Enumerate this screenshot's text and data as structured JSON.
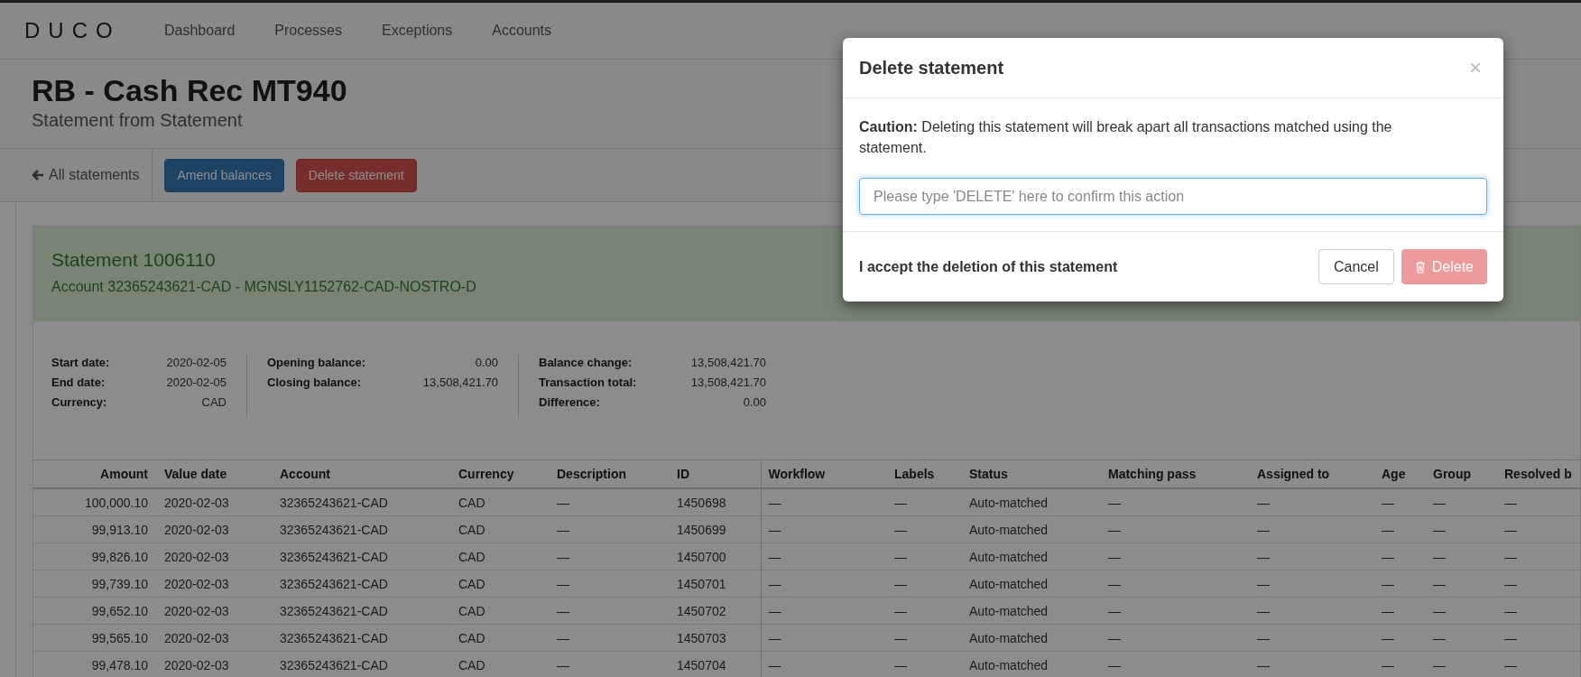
{
  "nav": {
    "logo": "DUCO",
    "items": [
      {
        "label": "Dashboard",
        "selected": false
      },
      {
        "label": "Processes",
        "selected": false
      },
      {
        "label": "Exceptions",
        "selected": false
      },
      {
        "label": "Accounts",
        "selected": false
      }
    ]
  },
  "page_header": {
    "title": "RB - Cash Rec MT940",
    "subtitle": "Statement from Statement"
  },
  "toolbar": {
    "back_link": "All statements",
    "buttons": [
      {
        "label": "Amend balances",
        "kind": "primary"
      },
      {
        "label": "Delete statement",
        "kind": "danger"
      }
    ]
  },
  "statement": {
    "title": "Statement 1006110",
    "account": "Account 32365243621-CAD - MGNSLY1152762-CAD-NOSTRO-D",
    "detail_groups": [
      [
        {
          "label": "Start date:",
          "value": "2020-02-05"
        },
        {
          "label": "End date:",
          "value": "2020-02-05"
        },
        {
          "label": "Currency:",
          "value": "CAD"
        }
      ],
      [
        {
          "label": "Opening balance:",
          "value": "0.00"
        },
        {
          "label": "Closing balance:",
          "value": "13,508,421.70"
        }
      ],
      [
        {
          "label": "Balance change:",
          "value": "13,508,421.70"
        },
        {
          "label": "Transaction total:",
          "value": "13,508,421.70"
        },
        {
          "label": "Difference:",
          "value": "0.00"
        }
      ]
    ]
  },
  "table": {
    "columns": [
      "Amount",
      "Value date",
      "Account",
      "Currency",
      "Description",
      "ID",
      "Workflow",
      "Labels",
      "Status",
      "Matching pass",
      "Assigned to",
      "Age",
      "Group",
      "Resolved b"
    ],
    "rows": [
      [
        "100,000.10",
        "2020-02-03",
        "32365243621-CAD",
        "CAD",
        "—",
        "1450698",
        "—",
        "—",
        "Auto-matched",
        "—",
        "—",
        "—",
        "—",
        "—"
      ],
      [
        "99,913.10",
        "2020-02-03",
        "32365243621-CAD",
        "CAD",
        "—",
        "1450699",
        "—",
        "—",
        "Auto-matched",
        "—",
        "—",
        "—",
        "—",
        "—"
      ],
      [
        "99,826.10",
        "2020-02-03",
        "32365243621-CAD",
        "CAD",
        "—",
        "1450700",
        "—",
        "—",
        "Auto-matched",
        "—",
        "—",
        "—",
        "—",
        "—"
      ],
      [
        "99,739.10",
        "2020-02-03",
        "32365243621-CAD",
        "CAD",
        "—",
        "1450701",
        "—",
        "—",
        "Auto-matched",
        "—",
        "—",
        "—",
        "—",
        "—"
      ],
      [
        "99,652.10",
        "2020-02-03",
        "32365243621-CAD",
        "CAD",
        "—",
        "1450702",
        "—",
        "—",
        "Auto-matched",
        "—",
        "—",
        "—",
        "—",
        "—"
      ],
      [
        "99,565.10",
        "2020-02-03",
        "32365243621-CAD",
        "CAD",
        "—",
        "1450703",
        "—",
        "—",
        "Auto-matched",
        "—",
        "—",
        "—",
        "—",
        "—"
      ],
      [
        "99,478.10",
        "2020-02-03",
        "32365243621-CAD",
        "CAD",
        "—",
        "1450704",
        "—",
        "—",
        "Auto-matched",
        "—",
        "—",
        "—",
        "—",
        "—"
      ]
    ]
  },
  "modal": {
    "title": "Delete statement",
    "close": "×",
    "message": "**Caution:** Deleting this statement will break apart all transactions matched using the statement.",
    "confirm_field": {
      "placeholder": "Please type 'DELETE' here to confirm this action"
    },
    "footer_label": "I accept the deletion of this statement",
    "cancel_button": "Cancel",
    "delete_button": {
      "label": "Delete",
      "disabled": true
    }
  }
}
